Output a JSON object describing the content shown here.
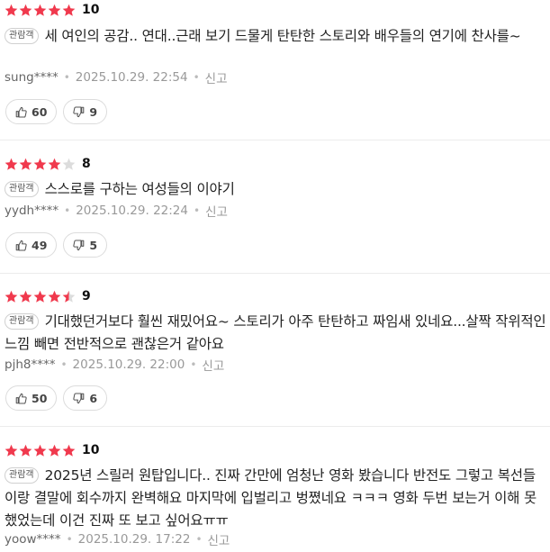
{
  "colors": {
    "star_filled": "#f0394d",
    "star_empty": "#dcdcdc",
    "divider": "#ececec"
  },
  "reviews": [
    {
      "rating": 5,
      "score": "10",
      "badge": "관람객",
      "text": "세 여인의 공감.. 연대..근래 보기 드물게 탄탄한 스토리와 배우들의 연기에 찬사를~",
      "user": "sung****",
      "date": "2025.10.29. 22:54",
      "report": "신고",
      "likes": "60",
      "dislikes": "9"
    },
    {
      "rating": 4,
      "score": "8",
      "badge": "관람객",
      "text": "스스로를 구하는 여성들의 이야기",
      "user": "yydh****",
      "date": "2025.10.29. 22:24",
      "report": "신고",
      "likes": "49",
      "dislikes": "5"
    },
    {
      "rating": 4.5,
      "score": "9",
      "badge": "관람객",
      "text": "기대했던거보다 훨씬 재밌어요~ 스토리가 아주 탄탄하고 짜임새 있네요...살짝 작위적인 느낌 빼면 전반적으로 괜찮은거 같아요",
      "user": "pjh8****",
      "date": "2025.10.29. 22:00",
      "report": "신고",
      "likes": "50",
      "dislikes": "6"
    },
    {
      "rating": 5,
      "score": "10",
      "badge": "관람객",
      "text": "2025년 스릴러 원탑입니다.. 진짜 간만에 엄청난 영화 봤습니다 반전도 그렇고 복선들이랑 결말에 회수까지 완벽해요 마지막에 입벌리고 벙쪘네요 ㅋㅋㅋ 영화 두번 보는거 이해 못했었는데 이건 진짜 또 보고 싶어요ㅠㅠ",
      "user": "yoow****",
      "date": "2025.10.29. 17:22",
      "report": "신고"
    }
  ]
}
